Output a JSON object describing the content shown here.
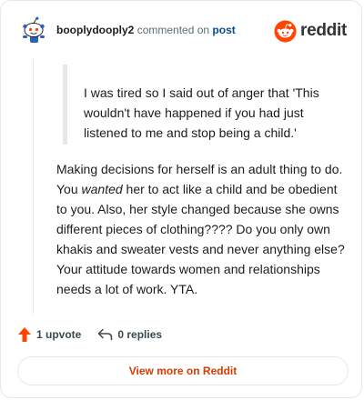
{
  "header": {
    "username": "booplydooply2",
    "action_text": "commented on",
    "post_link": "post",
    "brand": "reddit"
  },
  "comment": {
    "quote": "I was tired so I said out of anger that 'This wouldn't have happened if you had just listened to me and stop being a child.'",
    "body_part1": "Making decisions for herself is an adult thing to do. You ",
    "body_emphasis": "wanted",
    "body_part2": " her to act like a child and be obedient to you. Also, her style changed because she owns different pieces of clothing???? Do you only own khakis and sweater vests and never anything else? Your attitude towards women and relationships needs a lot of work. YTA."
  },
  "actions": {
    "upvotes": "1 upvote",
    "replies": "0 replies"
  },
  "footer": {
    "view_more": "View more on Reddit"
  },
  "colors": {
    "brand_orange": "#ff4500",
    "link_blue": "#0a4a8b",
    "cta_orange": "#d93a00"
  },
  "icons": [
    "avatar-snoo-icon",
    "reddit-logo-icon",
    "upvote-arrow-icon",
    "reply-arrow-icon"
  ]
}
